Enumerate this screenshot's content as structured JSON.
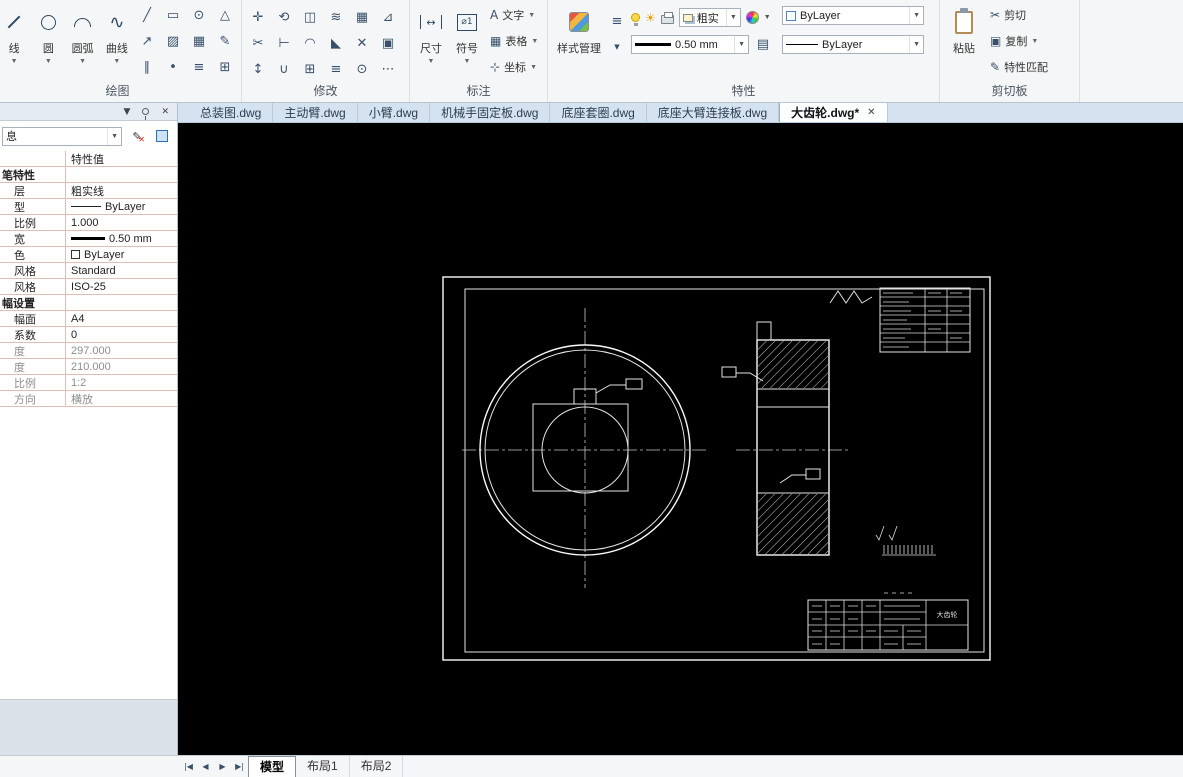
{
  "ribbon": {
    "group_labels": [
      "绘图",
      "修改",
      "标注",
      "特性",
      "剪切板"
    ],
    "draw": {
      "big": [
        {
          "label": "线"
        },
        {
          "label": "圆"
        },
        {
          "label": "圆弧"
        },
        {
          "label": "曲线"
        }
      ]
    },
    "annotate": {
      "big": [
        {
          "label": "尺寸"
        },
        {
          "label": "符号"
        }
      ],
      "small": [
        {
          "label": "文字"
        },
        {
          "label": "表格"
        },
        {
          "label": "坐标"
        }
      ]
    },
    "properties": {
      "style_manager": "样式管理",
      "layer_fragment": "粗实",
      "lineweight": "0.50 mm",
      "color_value": "ByLayer",
      "linetype_value": "ByLayer"
    },
    "clipboard": {
      "paste": "粘贴",
      "cut": "剪切",
      "copy": "复制",
      "match": "特性匹配"
    }
  },
  "doc_tabs": [
    {
      "label": "总装图.dwg"
    },
    {
      "label": "主动臂.dwg"
    },
    {
      "label": "小臂.dwg"
    },
    {
      "label": "机械手固定板.dwg"
    },
    {
      "label": "底座套圈.dwg"
    },
    {
      "label": "底座大臂连接板.dwg"
    },
    {
      "label": "大齿轮.dwg*"
    }
  ],
  "panel": {
    "title_fragment": "息",
    "value_header": "特性值",
    "rows": [
      {
        "label": "笔特性",
        "value": "",
        "type": "section"
      },
      {
        "label": "层",
        "value": "粗实线",
        "type": "text"
      },
      {
        "label": "型",
        "value": "ByLayer",
        "type": "linetype"
      },
      {
        "label": "比例",
        "value": "1.000",
        "type": "text"
      },
      {
        "label": "宽",
        "value": "0.50 mm",
        "type": "lineweight"
      },
      {
        "label": "色",
        "value": "ByLayer",
        "type": "color"
      },
      {
        "label": "风格",
        "value": "Standard",
        "type": "text"
      },
      {
        "label": "风格",
        "value": "ISO-25",
        "type": "text"
      },
      {
        "label": "幅设置",
        "value": "",
        "type": "section"
      },
      {
        "label": "幅面",
        "value": "A4",
        "type": "text"
      },
      {
        "label": "系数",
        "value": "0",
        "type": "text"
      },
      {
        "label": "度",
        "value": "297.000",
        "type": "muted"
      },
      {
        "label": "度",
        "value": "210.000",
        "type": "muted"
      },
      {
        "label": "比例",
        "value": "1:2",
        "type": "muted"
      },
      {
        "label": "方向",
        "value": "横放",
        "type": "muted"
      }
    ]
  },
  "layout_tabs": [
    {
      "label": "模型"
    },
    {
      "label": "布局1"
    },
    {
      "label": "布局2"
    }
  ],
  "drawing": {
    "title_block_text": "大齿轮"
  }
}
